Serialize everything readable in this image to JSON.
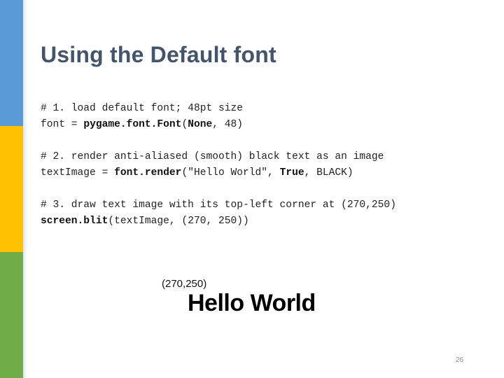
{
  "sidebar": {
    "colors": [
      "#5b9bd5",
      "#ffc000",
      "#70ad47"
    ]
  },
  "slide": {
    "title": "Using the Default font",
    "code_blocks": [
      {
        "comment": "# 1. load default font; 48pt size",
        "line": {
          "pre": "font = ",
          "bold1": "pygame.font.Font",
          "mid": "(",
          "bold2": "None",
          "post": ", 48)"
        }
      },
      {
        "comment": "# 2. render anti-aliased (smooth) black text as an image",
        "line": {
          "pre": "textImage = ",
          "bold1": "font.render",
          "mid": "(\"Hello World\", ",
          "bold2": "True",
          "post": ", BLACK)"
        }
      },
      {
        "comment": "# 3. draw text image with its top-left corner at (270,250)",
        "line": {
          "pre": "",
          "bold1": "screen.blit",
          "mid": "(textImage, (270, 250))",
          "bold2": "",
          "post": ""
        }
      }
    ],
    "demo": {
      "coord_label": "(270,250)",
      "hello_text": "Hello World"
    },
    "page_number": "26"
  }
}
